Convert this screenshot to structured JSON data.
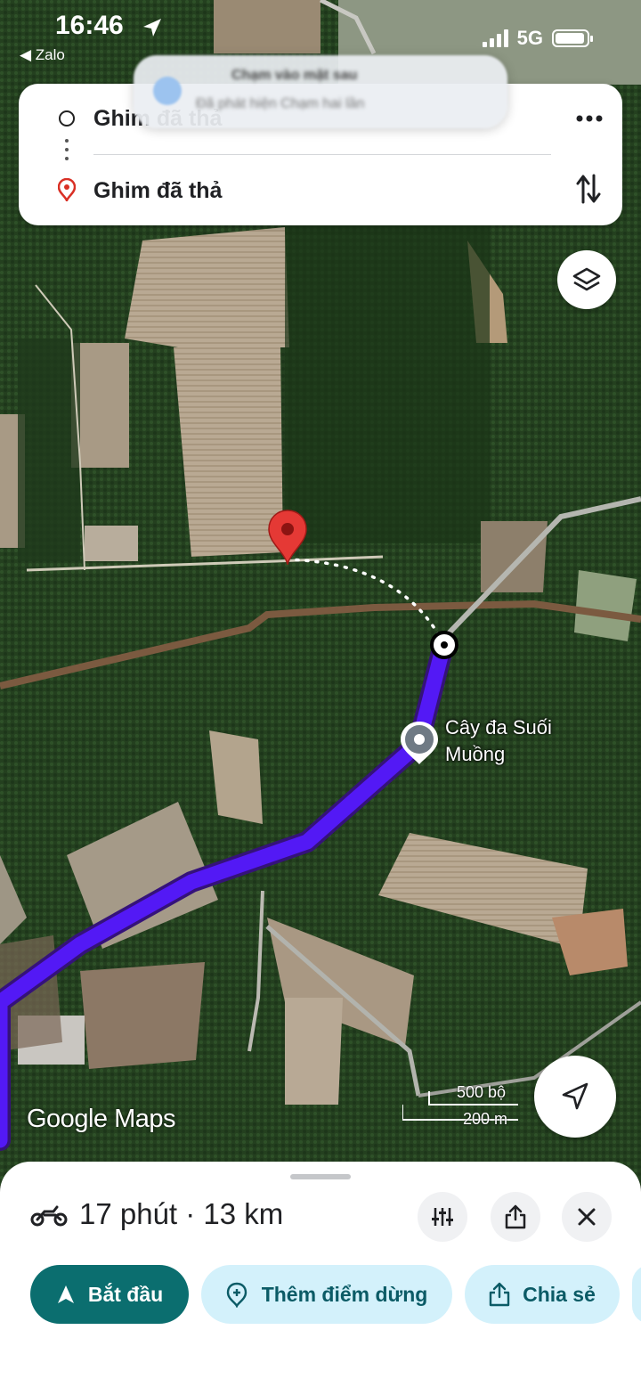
{
  "status_bar": {
    "time": "16:46",
    "back_app": "◀ Zalo",
    "network": "5G"
  },
  "notification": {
    "title": "Chạm vào mặt sau",
    "body": "Đã phát hiện Chạm hai lần"
  },
  "route_card": {
    "origin": "Ghim đã thả",
    "destination": "Ghim đã thả",
    "more_icon": "more-horizontal-icon",
    "swap_icon": "swap-vertical-icon"
  },
  "map": {
    "place_label": "Cây đa Suối Muồng",
    "scale_imperial": "500 bộ",
    "scale_metric": "200 m",
    "logo": "Google Maps",
    "route_color": "#5319f5",
    "pin_color": "#e53935"
  },
  "sheet": {
    "trip_summary": "17 phút · 13 km",
    "mode_icon": "motorbike-icon",
    "start_label": "Bắt đầu",
    "add_stop_label": "Thêm điểm dừng",
    "share_label": "Chia sẻ"
  }
}
